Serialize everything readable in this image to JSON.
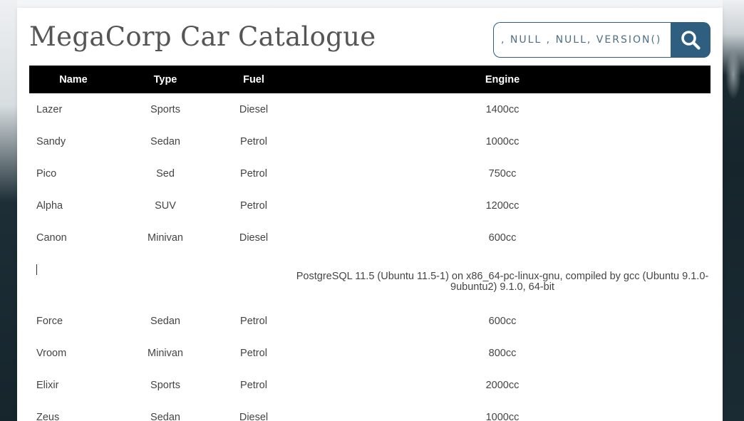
{
  "header": {
    "title": "MegaCorp Car Catalogue"
  },
  "search": {
    "value": ", NULL , NULL, VERSION() --",
    "button_icon": "search-icon"
  },
  "table": {
    "columns": [
      "Name",
      "Type",
      "Fuel",
      "Engine"
    ],
    "rows": [
      {
        "name": "Lazer",
        "type": "Sports",
        "fuel": "Diesel",
        "engine": "1400cc"
      },
      {
        "name": "Sandy",
        "type": "Sedan",
        "fuel": "Petrol",
        "engine": "1000cc"
      },
      {
        "name": "Pico",
        "type": "Sed",
        "fuel": "Petrol",
        "engine": "750cc"
      },
      {
        "name": "Alpha",
        "type": "SUV",
        "fuel": "Petrol",
        "engine": "1200cc"
      },
      {
        "name": "Canon",
        "type": "Minivan",
        "fuel": "Diesel",
        "engine": "600cc"
      },
      {
        "name": "",
        "type": "",
        "fuel": "",
        "engine": "PostgreSQL 11.5 (Ubuntu 11.5-1) on x86_64-pc-linux-gnu, compiled by gcc (Ubuntu 9.1.0-9ubuntu2) 9.1.0, 64-bit"
      },
      {
        "name": "Force",
        "type": "Sedan",
        "fuel": "Petrol",
        "engine": "600cc"
      },
      {
        "name": "Vroom",
        "type": "Minivan",
        "fuel": "Petrol",
        "engine": "800cc"
      },
      {
        "name": "Elixir",
        "type": "Sports",
        "fuel": "Petrol",
        "engine": "2000cc"
      },
      {
        "name": "Zeus",
        "type": "Sedan",
        "fuel": "Diesel",
        "engine": "1000cc"
      }
    ]
  },
  "colors": {
    "accent": "#2e5f80",
    "header_bg": "#000000",
    "title": "#555555"
  }
}
